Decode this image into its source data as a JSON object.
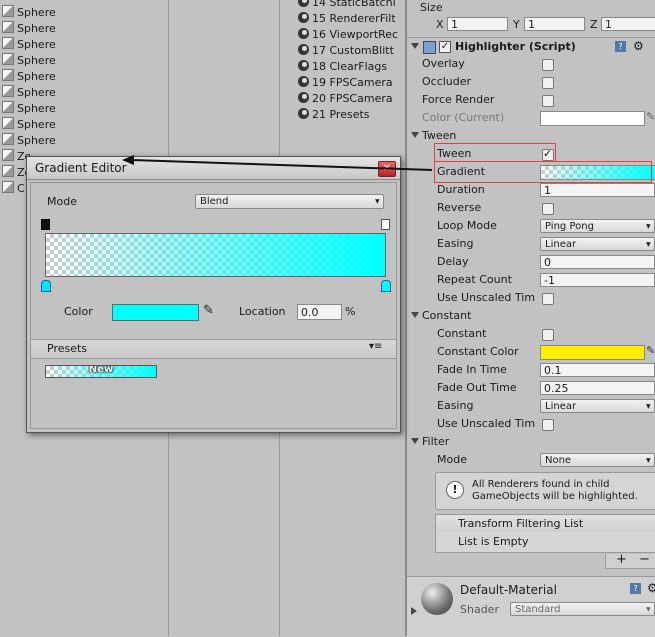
{
  "hierarchy": {
    "items": [
      {
        "label": "Sphere"
      },
      {
        "label": "Sphere"
      },
      {
        "label": "Sphere"
      },
      {
        "label": "Sphere"
      },
      {
        "label": "Sphere"
      },
      {
        "label": "Sphere"
      },
      {
        "label": "Sphere"
      },
      {
        "label": "Sphere"
      },
      {
        "label": "Sphere"
      },
      {
        "label": "Zo"
      },
      {
        "label": "Zo"
      },
      {
        "label": "C"
      }
    ]
  },
  "project": {
    "items": [
      {
        "label": "14 StaticBatchi"
      },
      {
        "label": "15 RendererFilt"
      },
      {
        "label": "16 ViewportRec"
      },
      {
        "label": "17 CustomBlitt"
      },
      {
        "label": "18 ClearFlags"
      },
      {
        "label": "19 FPSCamera"
      },
      {
        "label": "20 FPSCamera"
      },
      {
        "label": "21 Presets"
      }
    ]
  },
  "gradient_editor": {
    "title": "Gradient Editor",
    "mode_label": "Mode",
    "mode_value": "Blend",
    "color_label": "Color",
    "color_value": "#00ffff",
    "location_label": "Location",
    "location_value": "0.0",
    "location_unit": "%",
    "presets_label": "Presets",
    "preset_new_label": "New",
    "close_icon": "close-icon"
  },
  "inspector": {
    "size_label": "Size",
    "size_x_label": "X",
    "size_x": "1",
    "size_y_label": "Y",
    "size_y": "1",
    "size_z_label": "Z",
    "size_z": "1",
    "component_title": "Highlighter (Script)",
    "overlay_label": "Overlay",
    "occluder_label": "Occluder",
    "force_render_label": "Force Render",
    "color_current_label": "Color (Current)",
    "tween_section": "Tween",
    "tween_label": "Tween",
    "gradient_label": "Gradient",
    "duration_label": "Duration",
    "duration_value": "1",
    "reverse_label": "Reverse",
    "loop_mode_label": "Loop Mode",
    "loop_mode_value": "Ping Pong",
    "easing_label": "Easing",
    "easing_value": "Linear",
    "delay_label": "Delay",
    "delay_value": "0",
    "repeat_label": "Repeat Count",
    "repeat_value": "-1",
    "unscaled_label": "Use Unscaled Tim",
    "constant_section": "Constant",
    "constant_label": "Constant",
    "constant_color_label": "Constant Color",
    "constant_color_value": "#ffee00",
    "fade_in_label": "Fade In Time",
    "fade_in_value": "0.1",
    "fade_out_label": "Fade Out Time",
    "fade_out_value": "0.25",
    "easing2_label": "Easing",
    "easing2_value": "Linear",
    "unscaled2_label": "Use Unscaled Tim",
    "filter_section": "Filter",
    "filter_mode_label": "Mode",
    "filter_mode_value": "None",
    "info_text_1": "All Renderers found in child",
    "info_text_2": "GameObjects will be highlighted.",
    "list_header": "Transform Filtering List",
    "list_empty": "List is Empty",
    "plus_label": "+",
    "minus_label": "−",
    "material_name": "Default-Material",
    "shader_label": "Shader",
    "shader_value": "Standard"
  },
  "colors": {
    "accent_red": "#e04040",
    "gradient_end": "#00ffff"
  }
}
